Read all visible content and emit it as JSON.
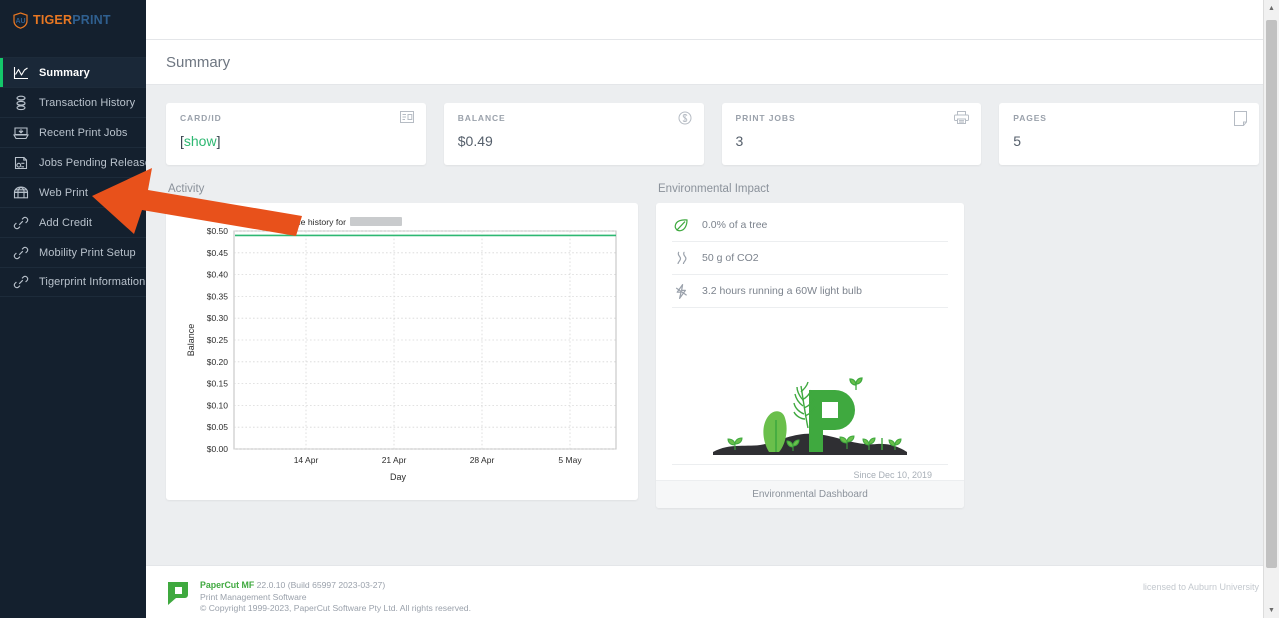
{
  "brand": {
    "logo_tiger": "TIGER",
    "logo_print": "PRINT",
    "logo_mark_icon": "auburn-au-logo-icon",
    "accent_orange": "#e87722",
    "accent_blue": "#2f5f8f",
    "accent_green": "#14c76a"
  },
  "sidebar": {
    "items": [
      {
        "label": "Summary",
        "icon": "chart-line-icon",
        "active": true
      },
      {
        "label": "Transaction History",
        "icon": "hourglass-icon",
        "active": false
      },
      {
        "label": "Recent Print Jobs",
        "icon": "printer-tray-icon",
        "active": false
      },
      {
        "label": "Jobs Pending Release",
        "icon": "pending-release-icon",
        "active": false
      },
      {
        "label": "Web Print",
        "icon": "web-print-globe-icon",
        "active": false
      },
      {
        "label": "Add Credit",
        "icon": "link-icon",
        "active": false
      },
      {
        "label": "Mobility Print Setup",
        "icon": "link-icon",
        "active": false
      },
      {
        "label": "Tigerprint Information",
        "icon": "link-icon",
        "active": false
      }
    ]
  },
  "header": {
    "page_title": "Summary"
  },
  "cards": [
    {
      "label": "CARD/ID",
      "value_prefix": "[",
      "value_link": "show",
      "value_suffix": "]",
      "icon": "card-id-icon"
    },
    {
      "label": "BALANCE",
      "value": "$0.49",
      "icon": "dollar-circle-icon"
    },
    {
      "label": "PRINT JOBS",
      "value": "3",
      "icon": "printer-icon"
    },
    {
      "label": "PAGES",
      "value": "5",
      "icon": "page-icon"
    }
  ],
  "activity": {
    "heading": "Activity"
  },
  "environment": {
    "heading": "Environmental Impact",
    "rows": [
      {
        "icon": "leaf-icon",
        "text": "0.0% of a tree"
      },
      {
        "icon": "co2-smoke-icon",
        "text": "50 g of CO2"
      },
      {
        "icon": "lightning-bolt-icon",
        "text": "3.2 hours running a 60W light bulb"
      }
    ],
    "since": "Since Dec 10, 2019",
    "dashboard_link": "Environmental Dashboard",
    "art_icon": "papercut-plant-growth-icon"
  },
  "footer": {
    "logo_icon": "papercut-logo-icon",
    "product": "PaperCut MF",
    "version": "22.0.10 (Build 65997 2023-03-27)",
    "tagline": "Print Management Software",
    "copyright": "© Copyright 1999-2023, PaperCut Software Pty Ltd. All rights reserved.",
    "licensed_to": "licensed to Auburn University"
  },
  "annotation": {
    "arrow_icon": "orange-left-arrow-annotation",
    "color": "#e8511b"
  },
  "scrollbar": {
    "up_arrow": "▲",
    "down_arrow": "▼"
  },
  "chart_data": {
    "type": "line",
    "title": "Balance history for",
    "title_redacted": true,
    "xlabel": "Day",
    "ylabel": "Balance",
    "x_tick_labels": [
      "14 Apr",
      "21 Apr",
      "28 Apr",
      "5 May"
    ],
    "y_tick_labels": [
      "$0.00",
      "$0.05",
      "$0.10",
      "$0.15",
      "$0.20",
      "$0.25",
      "$0.30",
      "$0.35",
      "$0.40",
      "$0.45",
      "$0.50"
    ],
    "ylim": [
      0,
      0.5
    ],
    "grid": true,
    "legend": "none",
    "line_color": "#2eb872",
    "series": [
      {
        "name": "Balance",
        "x": [
          "10 Apr",
          "14 Apr",
          "21 Apr",
          "28 Apr",
          "5 May",
          "10 May"
        ],
        "values": [
          0.49,
          0.49,
          0.49,
          0.49,
          0.49,
          0.49
        ]
      }
    ]
  }
}
